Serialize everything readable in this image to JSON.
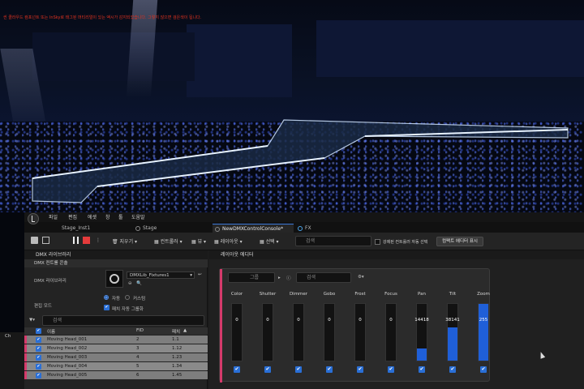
{
  "viewport": {
    "warning": "씬 클라우드 컴포넌트 또는 InSky로 태그된 머티리얼이 있는 액시가 감지되었습니다. 그렇지 않으면 검은색이 됩니다."
  },
  "menu": {
    "items": [
      "파일",
      "편집",
      "에셋",
      "창",
      "툴",
      "도움말"
    ]
  },
  "tabs": [
    {
      "label": "Stage_Inst1"
    },
    {
      "label": "Stage"
    },
    {
      "label": "NewDMXControlConsole*"
    },
    {
      "label": "FX"
    }
  ],
  "toolbar": {
    "clear_label": "지우기",
    "controller_label": "컨트롤러",
    "view_label": "뷰",
    "layout_label": "레이아웃",
    "select_label": "선택",
    "search_placeholder": "검색",
    "auto_select_label": "강제된 컨트롤러 자동 선택",
    "compact_editor_label": "컴팩트 에디터 표시"
  },
  "left_panel": {
    "title": "DMX 라이브러리",
    "section": "DMX 컨트롤 콘솔",
    "library_label": "DMX 라이브러리",
    "library_value": "DMXLib_Fixtures1",
    "edit_mode_label": "편집 모드",
    "radio_auto": "자동",
    "radio_custom": "커스텀",
    "auto_group_label": "패치 자동 그룹화",
    "search_placeholder": "검색",
    "columns": [
      "이름",
      "FID",
      "패치"
    ],
    "rows": [
      {
        "name": "Moving Head_001",
        "fid": "2",
        "patch": "1.1"
      },
      {
        "name": "Moving Head_002",
        "fid": "3",
        "patch": "1.12"
      },
      {
        "name": "Moving Head_003",
        "fid": "4",
        "patch": "1.23"
      },
      {
        "name": "Moving Head_004",
        "fid": "5",
        "patch": "1.34"
      },
      {
        "name": "Moving Head_005",
        "fid": "6",
        "patch": "1.45"
      }
    ],
    "side_tab": "Ch"
  },
  "layout_editor": {
    "title": "레이아웃 에디터",
    "group_label": "그룹",
    "search_placeholder": "검색",
    "channels": [
      {
        "name": "Color",
        "value": "0",
        "level": 0
      },
      {
        "name": "Shutter",
        "value": "0",
        "level": 0
      },
      {
        "name": "Dimmer",
        "value": "0",
        "level": 0
      },
      {
        "name": "Gobo",
        "value": "0",
        "level": 0
      },
      {
        "name": "Frost",
        "value": "0",
        "level": 0
      },
      {
        "name": "Focus",
        "value": "0",
        "level": 0
      },
      {
        "name": "Pan",
        "value": "14418",
        "level": 0.22
      },
      {
        "name": "Tilt",
        "value": "38141",
        "level": 0.58
      },
      {
        "name": "Zoom",
        "value": "255",
        "level": 1.0
      }
    ]
  },
  "colors": {
    "accent": "#1f5fd8",
    "stripe": "#d63a6b",
    "warning": "#e0321f"
  }
}
